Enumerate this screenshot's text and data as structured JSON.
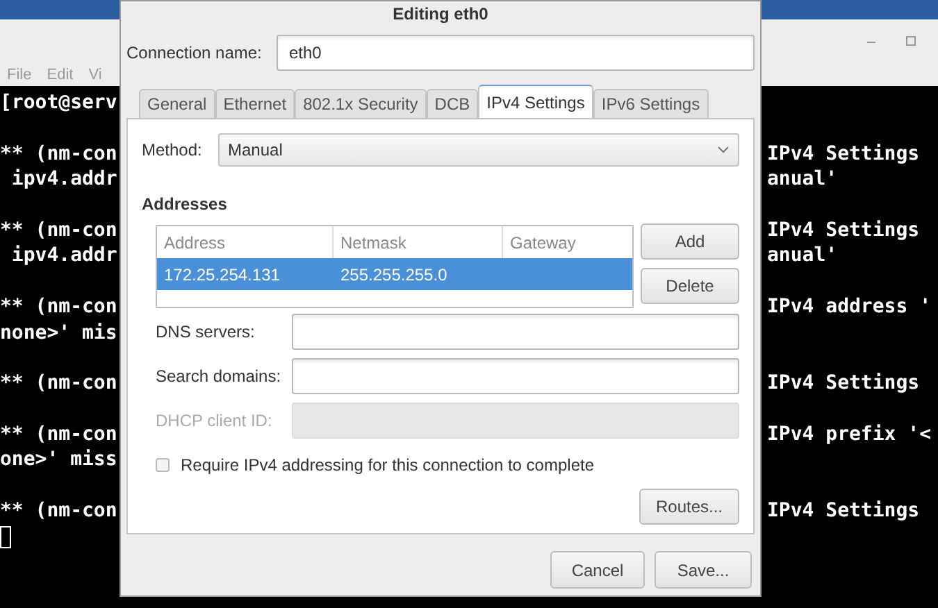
{
  "terminal": {
    "menu": [
      "File",
      "Edit",
      "Vi"
    ],
    "blocks": [
      [
        {
          "left": "[root@serv"
        }
      ],
      [
        {
          "left": "** (nm-con",
          "right": "IPv4 Settings"
        },
        {
          "left": " ipv4.addr",
          "right": "anual'"
        }
      ],
      [
        {
          "left": "** (nm-con",
          "right": "IPv4 Settings"
        },
        {
          "left": " ipv4.addr",
          "right": "anual'"
        }
      ],
      [
        {
          "left": "** (nm-con",
          "right": "IPv4 address '"
        },
        {
          "left": "none>' mis"
        }
      ],
      [
        {
          "left": "** (nm-con",
          "right": "IPv4 Settings"
        }
      ],
      [
        {
          "left": "** (nm-con",
          "right": "IPv4 prefix '<"
        },
        {
          "left": "one>' miss"
        }
      ],
      [
        {
          "left": "** (nm-con",
          "right": "IPv4 Settings"
        }
      ]
    ]
  },
  "dialog": {
    "title": "Editing eth0",
    "connection_name": {
      "label": "Connection name:",
      "value": "eth0"
    },
    "tabs": [
      {
        "label": "General",
        "selected": false
      },
      {
        "label": "Ethernet",
        "selected": false
      },
      {
        "label": "802.1x Security",
        "selected": false
      },
      {
        "label": "DCB",
        "selected": false
      },
      {
        "label": "IPv4 Settings",
        "selected": true
      },
      {
        "label": "IPv6 Settings",
        "selected": false
      }
    ],
    "method": {
      "label": "Method:",
      "value": "Manual"
    },
    "addresses": {
      "title": "Addresses",
      "columns": [
        "Address",
        "Netmask",
        "Gateway"
      ],
      "rows": [
        {
          "address": "172.25.254.131",
          "netmask": "255.255.255.0",
          "selected": true
        }
      ],
      "buttons": [
        "Add",
        "Delete"
      ]
    },
    "fields": [
      {
        "label": "DNS servers:",
        "disabled": false
      },
      {
        "label": "Search domains:",
        "disabled": false
      },
      {
        "label": "DHCP client ID:",
        "disabled": true
      }
    ],
    "require_checkbox": {
      "label": "Require IPv4 addressing for this connection to complete",
      "checked": false
    },
    "routes_button": "Routes...",
    "footer_buttons": [
      "Cancel",
      "Save..."
    ]
  }
}
